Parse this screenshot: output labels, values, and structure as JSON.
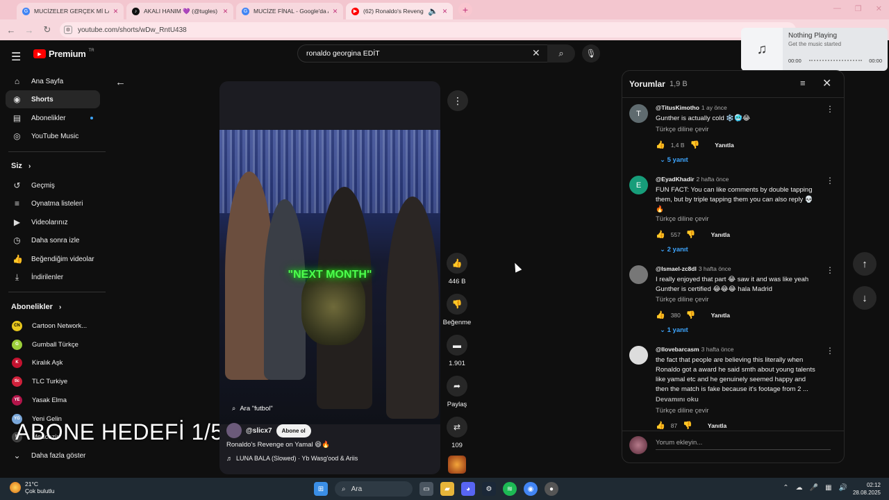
{
  "browser": {
    "tabs": [
      {
        "label": "MUCİZELER GERÇEK Mİ LADYİ",
        "icon": "chrome-icon",
        "color": "#4285f4"
      },
      {
        "label": "AKALI HANIM 💜 (@tugles) | T",
        "icon": "tiktok-icon",
        "color": "#111111"
      },
      {
        "label": "MUCİZE FİNAL - Google'da Ara",
        "icon": "google-icon",
        "color": "#4285f4"
      },
      {
        "label": "(62) Ronaldo's Revenge on",
        "icon": "youtube-icon",
        "color": "#ff0000"
      }
    ],
    "url": "youtube.com/shorts/wDw_RntU438"
  },
  "header": {
    "brand": "Premium",
    "region": "TR",
    "search_value": "ronaldo georgina EDİT"
  },
  "sidebar": {
    "main": [
      {
        "label": "Ana Sayfa",
        "icon": "home-icon",
        "glyph": "⌂"
      },
      {
        "label": "Shorts",
        "icon": "shorts-icon",
        "glyph": "◉"
      },
      {
        "label": "Abonelikler",
        "icon": "subscriptions-icon",
        "glyph": "▤"
      },
      {
        "label": "YouTube Music",
        "icon": "music-icon",
        "glyph": "◎"
      }
    ],
    "you_title": "Siz",
    "you": [
      {
        "label": "Geçmiş",
        "icon": "history-icon",
        "glyph": "↺"
      },
      {
        "label": "Oynatma listeleri",
        "icon": "playlist-icon",
        "glyph": "≡"
      },
      {
        "label": "Videolarınız",
        "icon": "your-videos-icon",
        "glyph": "▶"
      },
      {
        "label": "Daha sonra izle",
        "icon": "watch-later-icon",
        "glyph": "◷"
      },
      {
        "label": "Beğendiğim videolar",
        "icon": "liked-icon",
        "glyph": "👍"
      },
      {
        "label": "İndirilenler",
        "icon": "downloads-icon",
        "glyph": "⤓"
      }
    ],
    "subs_title": "Abonelikler",
    "subs": [
      {
        "label": "Cartoon Network...",
        "color": "#e9c81d",
        "glyph": "CN"
      },
      {
        "label": "Gumball Türkçe",
        "color": "#9bcf3a",
        "glyph": "G"
      },
      {
        "label": "Kiralık Aşk",
        "color": "#c4122f",
        "glyph": "K"
      },
      {
        "label": "TLC Turkiye",
        "color": "#d0213b",
        "glyph": "tlc"
      },
      {
        "label": "Yasak Elma",
        "color": "#b3154a",
        "glyph": "YE"
      },
      {
        "label": "Yeni Gelin",
        "color": "#7aa7d9",
        "glyph": "YG"
      },
      {
        "label": "Medcezir",
        "color": "#444444",
        "glyph": "M"
      }
    ],
    "more": "Daha fazla göster"
  },
  "overlay_caption": "ABONE HEDEFİ 1/5",
  "short": {
    "video_text": "\"NEXT MONTH\"",
    "search_suggestion": "Ara \"futbol\"",
    "channel": "@slicx7",
    "subscribe_label": "Abone ol",
    "title": "Ronaldo's Revenge on Yamal 😆🔥",
    "music": "LUNA BALA (Slowed) · Yb Wasg'ood & Ariis"
  },
  "actions": {
    "likes": "446 B",
    "dislike_label": "Beğenme",
    "comments": "1.901",
    "share_label": "Paylaş",
    "remix": "109"
  },
  "comments_panel": {
    "title": "Yorumlar",
    "count": "1,9 B",
    "translate_label": "Türkçe diline çevir",
    "reply_label": "Yanıtla",
    "read_more": "Devamını oku",
    "add_placeholder": "Yorum ekleyin...",
    "items": [
      {
        "author": "@TitusKimotho",
        "time": "1 ay önce",
        "text": "Gunther is actually cold ❄️🥶😂",
        "likes": "1,4 B",
        "replies": "5 yanıt",
        "avatar_letter": "T",
        "avatar_color": "#5f6b6f"
      },
      {
        "author": "@EyadKhadir",
        "time": "2 hafta önce",
        "text": "FUN FACT: You can like comments by double tapping them, but by triple tapping them you can also reply 💀🔥",
        "likes": "557",
        "replies": "2 yanıt",
        "avatar_letter": "E",
        "avatar_color": "#179d7a"
      },
      {
        "author": "@Ismael-zc8dl",
        "time": "3 hafta önce",
        "text": "I really enjoyed that part 😂 saw it and was like yeah Gunther is certified 😂😂😂 hala Madrid",
        "likes": "380",
        "replies": "1 yanıt",
        "avatar_letter": "",
        "avatar_color": "#777777"
      },
      {
        "author": "@Ilovebarcasm",
        "time": "3 hafta önce",
        "text": "the fact that people are believing this literally when Ronaldo got a award he said smth about young talents like yamal etc and he genuinely seemed happy and then the match is fake because it's footage from 2 ...",
        "likes": "87",
        "replies": "",
        "avatar_letter": "",
        "avatar_color": "#dddddd"
      }
    ]
  },
  "music_popup": {
    "title": "Nothing Playing",
    "subtitle": "Get the music started",
    "start": "00:00",
    "end": "00:00"
  },
  "taskbar": {
    "temp": "21°C",
    "weather": "Çok bulutlu",
    "search": "Ara",
    "time": "02:12",
    "date": "28.08.2025"
  }
}
